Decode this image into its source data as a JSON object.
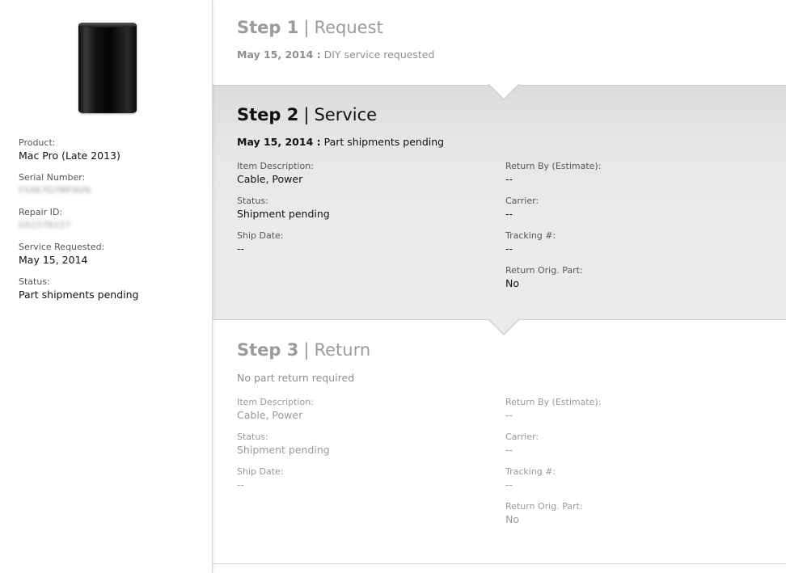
{
  "sidebar": {
    "image_alt": "Mac Pro",
    "items": [
      {
        "label": "Product:",
        "value": "Mac Pro (Late 2013)",
        "blurred": false
      },
      {
        "label": "Serial Number:",
        "value": "F5XK7D7MF9VN",
        "blurred": true
      },
      {
        "label": "Repair ID:",
        "value": "D51576127",
        "blurred": true
      },
      {
        "label": "Service Requested:",
        "value": "May 15, 2014",
        "blurred": false
      },
      {
        "label": "Status:",
        "value": "Part shipments pending",
        "blurred": false
      }
    ]
  },
  "steps": {
    "step1": {
      "number": "Step 1",
      "name": "Request",
      "date": "May 15, 2014 :",
      "status": "DIY service requested"
    },
    "step2": {
      "number": "Step 2",
      "name": "Service",
      "date": "May 15, 2014 :",
      "status": "Part shipments pending",
      "left": [
        {
          "label": "Item Description:",
          "value": "Cable, Power"
        },
        {
          "label": "Status:",
          "value": "Shipment pending"
        },
        {
          "label": "Ship Date:",
          "value": "--"
        }
      ],
      "right": [
        {
          "label": "Return By (Estimate):",
          "value": "--"
        },
        {
          "label": "Carrier:",
          "value": "--"
        },
        {
          "label": "Tracking #:",
          "value": "--"
        },
        {
          "label": "Return Orig. Part:",
          "value": "No"
        }
      ]
    },
    "step3": {
      "number": "Step 3",
      "name": "Return",
      "status": "No part return required",
      "left": [
        {
          "label": "Item Description:",
          "value": "Cable, Power"
        },
        {
          "label": "Status:",
          "value": "Shipment pending"
        },
        {
          "label": "Ship Date:",
          "value": "--"
        }
      ],
      "right": [
        {
          "label": "Return By (Estimate):",
          "value": "--"
        },
        {
          "label": "Carrier:",
          "value": "--"
        },
        {
          "label": "Tracking #:",
          "value": "--"
        },
        {
          "label": "Return Orig. Part:",
          "value": "No"
        }
      ]
    }
  },
  "colors": {
    "active_panel": "#ebebeb",
    "inactive_text": "#9b9b9b",
    "active_text": "#111111"
  }
}
